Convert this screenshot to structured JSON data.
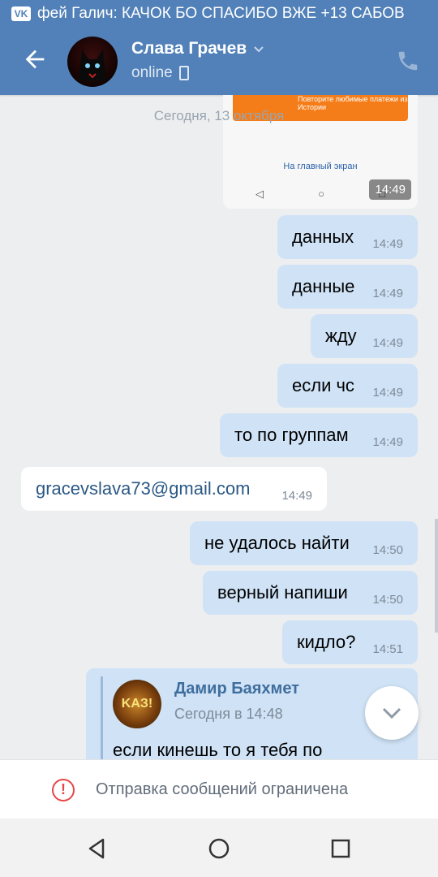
{
  "status_bar": {
    "app_badge": "VK",
    "ticker_text": "фей Галич: КАЧОК БО СПАСИБО ВЖЕ +13 САБОВ"
  },
  "header": {
    "contact_name": "Слава Грачев",
    "presence": "online",
    "icons": [
      "back-arrow-icon",
      "avatar",
      "chevron-down-icon",
      "mobile-icon",
      "phone-icon"
    ]
  },
  "screenshot_attachment": {
    "banner_text": "Повторите любимые платежи из Истории",
    "link_text": "На главный экран",
    "time": "14:49"
  },
  "date_separator": "Сегодня, 13 октября",
  "messages": [
    {
      "dir": "out",
      "text": "данных",
      "time": "14:49"
    },
    {
      "dir": "out",
      "text": "данные",
      "time": "14:49"
    },
    {
      "dir": "out",
      "text": "жду",
      "time": "14:49"
    },
    {
      "dir": "out",
      "text": "если чс",
      "time": "14:49"
    },
    {
      "dir": "out",
      "text": "то по группам",
      "time": "14:49"
    },
    {
      "dir": "in",
      "text": "gracevslava73@gmail.com",
      "time": "14:49"
    },
    {
      "dir": "out",
      "text": "не удалось найти",
      "time": "14:50"
    },
    {
      "dir": "out",
      "text": "верный напиши",
      "time": "14:50"
    },
    {
      "dir": "out",
      "text": "кидло?",
      "time": "14:51"
    }
  ],
  "forwarded": {
    "author": "Дамир Баяхмет",
    "when": "Сегодня в 14:48",
    "avatar_text": "KAЗ!",
    "text": "если кинешь то я тебя по"
  },
  "restriction": {
    "text": "Отправка сообщений ограничена"
  },
  "colors": {
    "header": "#5181b8",
    "outgoing_bubble": "#cfe2f6",
    "incoming_bubble": "#ffffff",
    "warning": "#e64646"
  }
}
